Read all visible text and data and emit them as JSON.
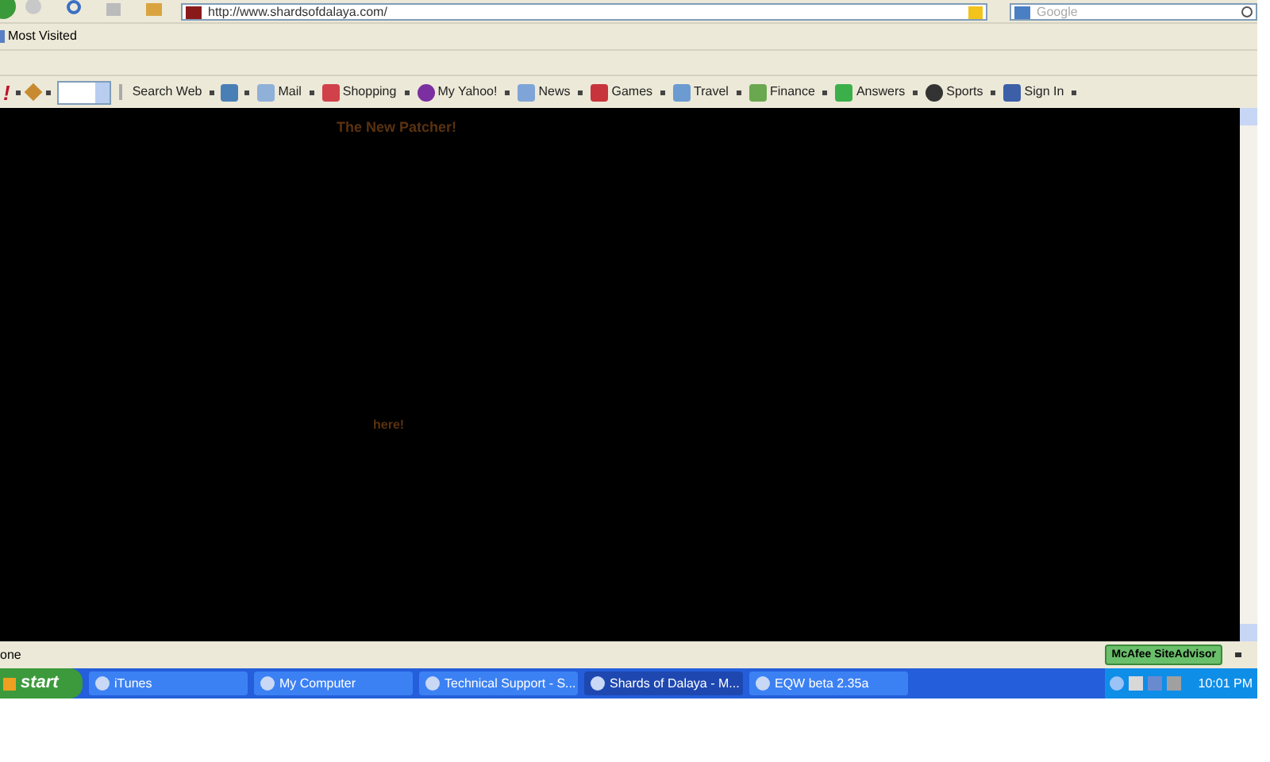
{
  "navigation": {
    "url": "http://www.shardsofdalaya.com/",
    "search_placeholder": "Google"
  },
  "bookmarks": [
    "Most Visited"
  ],
  "yahoo_toolbar": {
    "logo": "!",
    "items": [
      {
        "kind": "button",
        "label": "Search Web"
      },
      {
        "kind": "icon"
      },
      {
        "kind": "button",
        "label": "Mail"
      },
      {
        "kind": "button",
        "label": "Shopping"
      },
      {
        "kind": "button",
        "label": "My Yahoo!"
      },
      {
        "kind": "button",
        "label": "News"
      },
      {
        "kind": "button",
        "label": "Games"
      },
      {
        "kind": "button",
        "label": "Travel"
      },
      {
        "kind": "button",
        "label": "Finance"
      },
      {
        "kind": "button",
        "label": "Answers"
      },
      {
        "kind": "button",
        "label": "Sports"
      },
      {
        "kind": "button",
        "label": "Sign In"
      }
    ]
  },
  "page": {
    "heading": "The New Patcher!",
    "link": "here!"
  },
  "status_bar": {
    "text": "one",
    "badge": "McAfee SiteAdvisor"
  },
  "taskbar": {
    "start": "start",
    "tasks": [
      {
        "label": "iTunes",
        "selected": false
      },
      {
        "label": "My Computer",
        "selected": false
      },
      {
        "label": "Technical Support - S...",
        "selected": false
      },
      {
        "label": "Shards of Dalaya - M...",
        "selected": true
      },
      {
        "label": "EQW beta 2.35a",
        "selected": false
      }
    ],
    "clock": "10:01 PM"
  }
}
